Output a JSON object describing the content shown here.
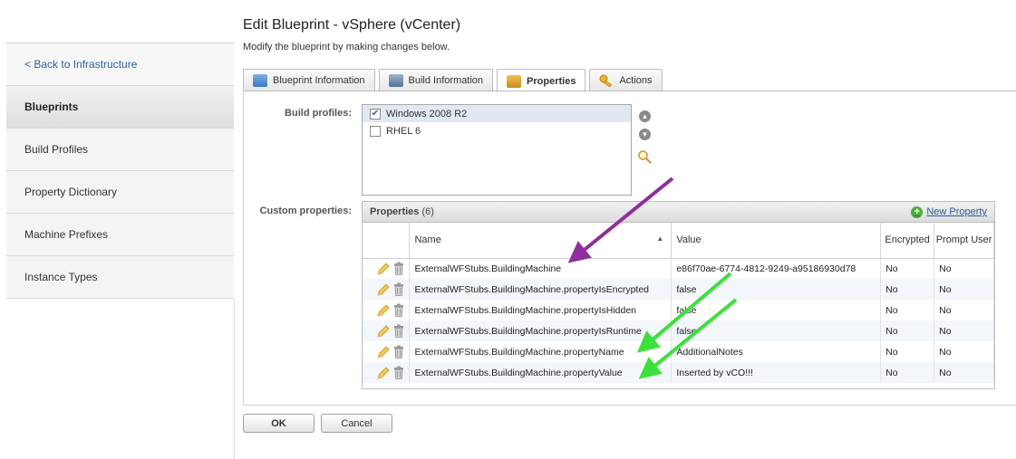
{
  "header": {
    "title": "Edit Blueprint - vSphere (vCenter)",
    "subtitle": "Modify the blueprint by making changes below."
  },
  "sidebar": {
    "items": [
      {
        "label": "< Back to Infrastructure"
      },
      {
        "label": "Blueprints"
      },
      {
        "label": "Build Profiles"
      },
      {
        "label": "Property Dictionary"
      },
      {
        "label": "Machine Prefixes"
      },
      {
        "label": "Instance Types"
      }
    ]
  },
  "tabs": [
    {
      "label": "Blueprint Information",
      "icon": "blueprint-info-icon"
    },
    {
      "label": "Build Information",
      "icon": "build-info-icon"
    },
    {
      "label": "Properties",
      "icon": "properties-icon"
    },
    {
      "label": "Actions",
      "icon": "actions-key-icon"
    }
  ],
  "build_profiles": {
    "label": "Build profiles:",
    "items": [
      {
        "label": "Windows 2008 R2",
        "checked": true
      },
      {
        "label": "RHEL 6",
        "checked": false
      }
    ]
  },
  "custom_properties": {
    "label": "Custom properties:",
    "grid_title": "Properties",
    "count": "(6)",
    "new_property": "New Property",
    "columns": {
      "name": "Name",
      "value": "Value",
      "encrypted": "Encrypted",
      "prompt_user": "Prompt User"
    },
    "rows": [
      {
        "name": "ExternalWFStubs.BuildingMachine",
        "value": "e86f70ae-6774-4812-9249-a95186930d78",
        "encrypted": "No",
        "prompt": "No"
      },
      {
        "name": "ExternalWFStubs.BuildingMachine.propertyIsEncrypted",
        "value": "false",
        "encrypted": "No",
        "prompt": "No"
      },
      {
        "name": "ExternalWFStubs.BuildingMachine.propertyIsHidden",
        "value": "false",
        "encrypted": "No",
        "prompt": "No"
      },
      {
        "name": "ExternalWFStubs.BuildingMachine.propertyIsRuntime",
        "value": "false",
        "encrypted": "No",
        "prompt": "No"
      },
      {
        "name": "ExternalWFStubs.BuildingMachine.propertyName",
        "value": "AdditionalNotes",
        "encrypted": "No",
        "prompt": "No"
      },
      {
        "name": "ExternalWFStubs.BuildingMachine.propertyValue",
        "value": "Inserted by vCO!!!",
        "encrypted": "No",
        "prompt": "No"
      }
    ]
  },
  "buttons": {
    "ok": "OK",
    "cancel": "Cancel"
  },
  "colors": {
    "annotation_purple": "#8e2e9c",
    "annotation_green": "#38e23a",
    "link_blue": "#2a5f9e"
  }
}
